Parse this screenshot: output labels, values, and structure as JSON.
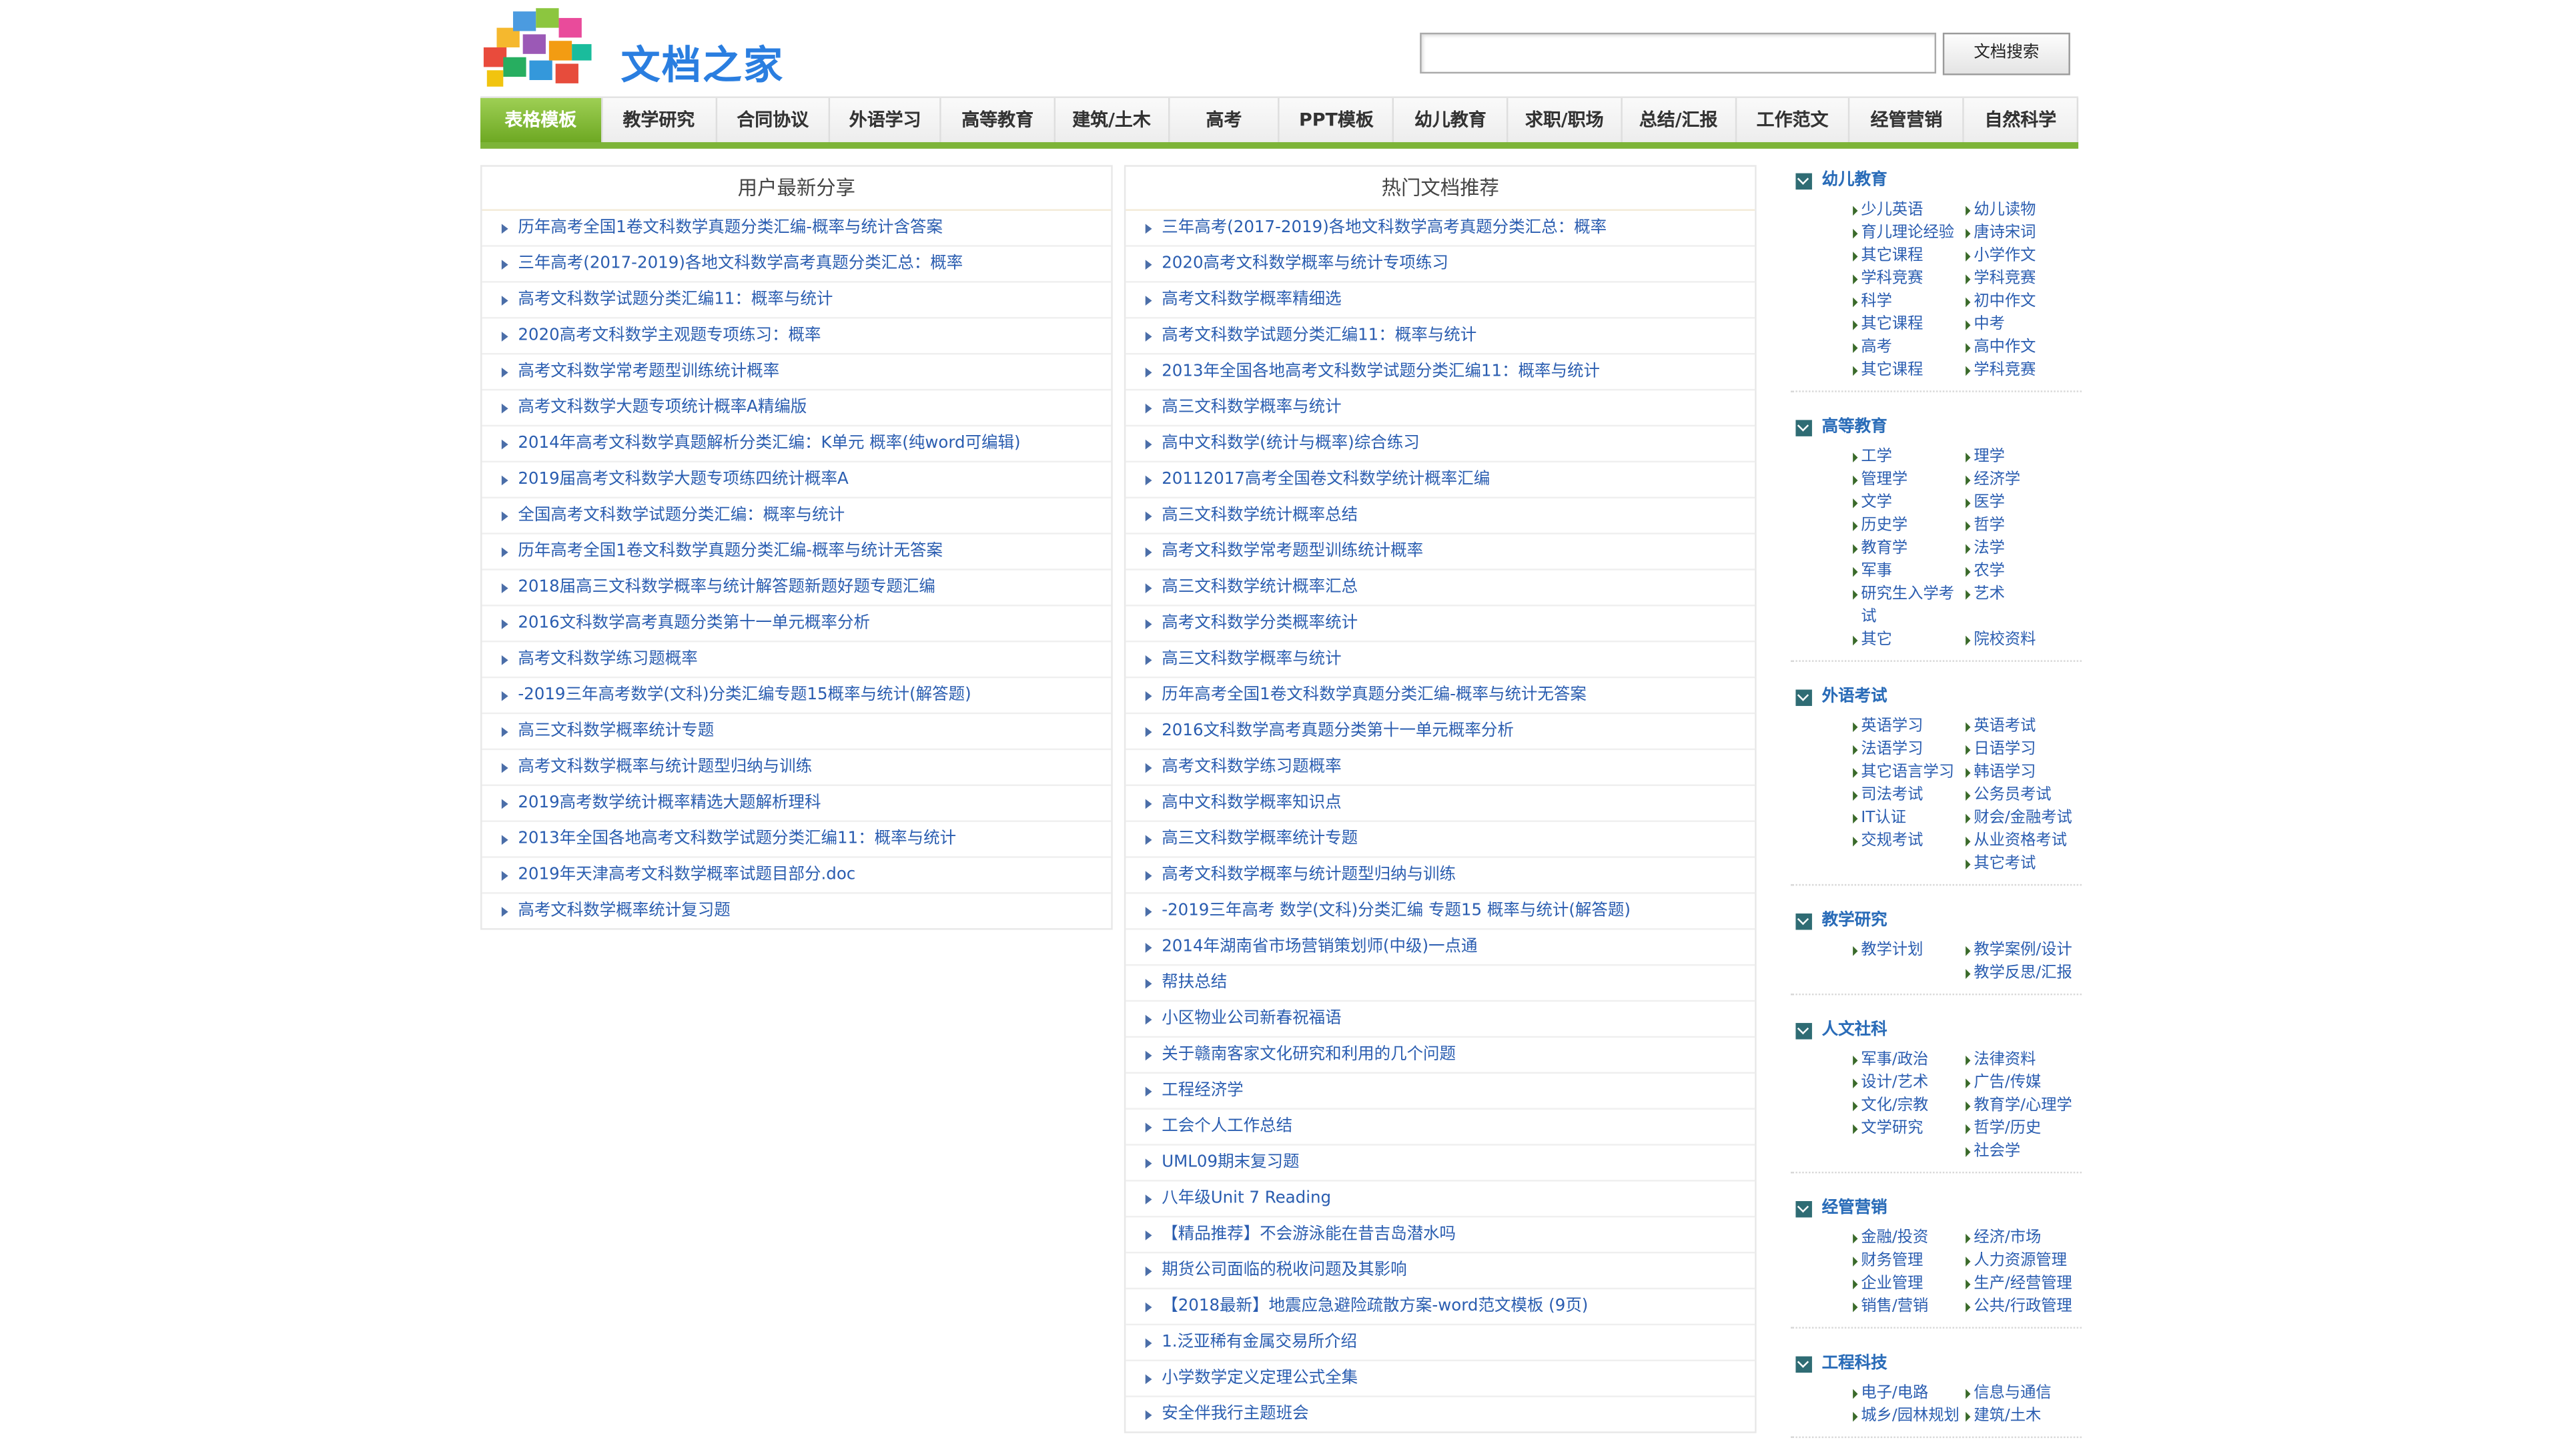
{
  "header": {
    "site_title": "文档之家",
    "search_button": "文档搜索",
    "search_value": ""
  },
  "nav": [
    "表格模板",
    "教学研究",
    "合同协议",
    "外语学习",
    "高等教育",
    "建筑/土木",
    "高考",
    "PPT模板",
    "幼儿教育",
    "求职/职场",
    "总结/汇报",
    "工作范文",
    "经管营销",
    "自然科学"
  ],
  "nav_active": 0,
  "left_panel": {
    "title": "用户最新分享",
    "items": [
      "历年高考全国1卷文科数学真题分类汇编-概率与统计含答案",
      "三年高考(2017-2019)各地文科数学高考真题分类汇总：概率",
      "高考文科数学试题分类汇编11：概率与统计",
      "2020高考文科数学主观题专项练习：概率",
      "高考文科数学常考题型训练统计概率",
      "高考文科数学大题专项统计概率A精编版",
      "2014年高考文科数学真题解析分类汇编：K单元 概率(纯word可编辑)",
      "2019届高考文科数学大题专项练四统计概率A",
      "全国高考文科数学试题分类汇编：概率与统计",
      "历年高考全国1卷文科数学真题分类汇编-概率与统计无答案",
      "2018届高三文科数学概率与统计解答题新题好题专题汇编",
      "2016文科数学高考真题分类第十一单元概率分析",
      "高考文科数学练习题概率",
      "-2019三年高考数学(文科)分类汇编专题15概率与统计(解答题)",
      "高三文科数学概率统计专题",
      "高考文科数学概率与统计题型归纳与训练",
      "2019高考数学统计概率精选大题解析理科",
      "2013年全国各地高考文科数学试题分类汇编11：概率与统计",
      "2019年天津高考文科数学概率试题目部分.doc",
      "高考文科数学概率统计复习题"
    ]
  },
  "right_panel": {
    "title": "热门文档推荐",
    "items": [
      "三年高考(2017-2019)各地文科数学高考真题分类汇总：概率",
      "2020高考文科数学概率与统计专项练习",
      "高考文科数学概率精细选",
      "高考文科数学试题分类汇编11：概率与统计",
      "2013年全国各地高考文科数学试题分类汇编11：概率与统计",
      "高三文科数学概率与统计",
      "高中文科数学(统计与概率)综合练习",
      "20112017高考全国卷文科数学统计概率汇编",
      "高三文科数学统计概率总结",
      "高考文科数学常考题型训练统计概率",
      "高三文科数学统计概率汇总",
      "高考文科数学分类概率统计",
      "高三文科数学概率与统计",
      "历年高考全国1卷文科数学真题分类汇编-概率与统计无答案",
      "2016文科数学高考真题分类第十一单元概率分析",
      "高考文科数学练习题概率",
      "高中文科数学概率知识点",
      "高三文科数学概率统计专题",
      "高考文科数学概率与统计题型归纳与训练",
      "-2019三年高考 数学(文科)分类汇编 专题15 概率与统计(解答题)",
      "2014年湖南省市场营销策划师(中级)一点通",
      "帮扶总结",
      "小区物业公司新春祝福语",
      "关于赣南客家文化研究和利用的几个问题",
      "工程经济学",
      "工会个人工作总结",
      "UML09期末复习题",
      "八年级Unit 7 Reading",
      "【精品推荐】不会游泳能在昔吉岛潜水吗",
      "期货公司面临的税收问题及其影响",
      "【2018最新】地震应急避险疏散方案-word范文模板 (9页)",
      "1.泛亚稀有金属交易所介绍",
      "小学数学定义定理公式全集",
      "安全伴我行主题班会"
    ]
  },
  "sidebar": [
    {
      "name": "幼儿教育",
      "items": [
        "少儿英语",
        "幼儿读物",
        "育儿理论经验",
        "唐诗宋词",
        "其它课程",
        "小学作文",
        "学科竞赛",
        "学科竞赛",
        "科学",
        "初中作文",
        "其它课程",
        "中考",
        "高考",
        "高中作文",
        "其它课程",
        "学科竞赛"
      ]
    },
    {
      "name": "高等教育",
      "items": [
        "工学",
        "理学",
        "管理学",
        "经济学",
        "文学",
        "医学",
        "历史学",
        "哲学",
        "教育学",
        "法学",
        "军事",
        "农学",
        "研究生入学考试",
        "艺术",
        "其它",
        "院校资料"
      ]
    },
    {
      "name": "外语考试",
      "items": [
        "英语学习",
        "英语考试",
        "法语学习",
        "日语学习",
        "其它语言学习",
        "韩语学习",
        "司法考试",
        "公务员考试",
        "IT认证",
        "财会/金融考试",
        "交规考试",
        "从业资格考试",
        "",
        "其它考试"
      ]
    },
    {
      "name": "教学研究",
      "items": [
        "教学计划",
        "教学案例/设计",
        "",
        "教学反思/汇报"
      ]
    },
    {
      "name": "人文社科",
      "items": [
        "军事/政治",
        "法律资料",
        "设计/艺术",
        "广告/传媒",
        "文化/宗教",
        "教育学/心理学",
        "文学研究",
        "哲学/历史",
        "",
        "社会学"
      ]
    },
    {
      "name": "经管营销",
      "items": [
        "金融/投资",
        "经济/市场",
        "财务管理",
        "人力资源管理",
        "企业管理",
        "生产/经营管理",
        "销售/营销",
        "公共/行政管理"
      ]
    },
    {
      "name": "工程科技",
      "items": [
        "电子/电路",
        "信息与通信",
        "城乡/园林规划",
        "建筑/土木"
      ]
    }
  ],
  "colors": {
    "accent_green": "#7db438",
    "link_blue": "#2a5db0",
    "title_blue": "#2a7ee0"
  }
}
